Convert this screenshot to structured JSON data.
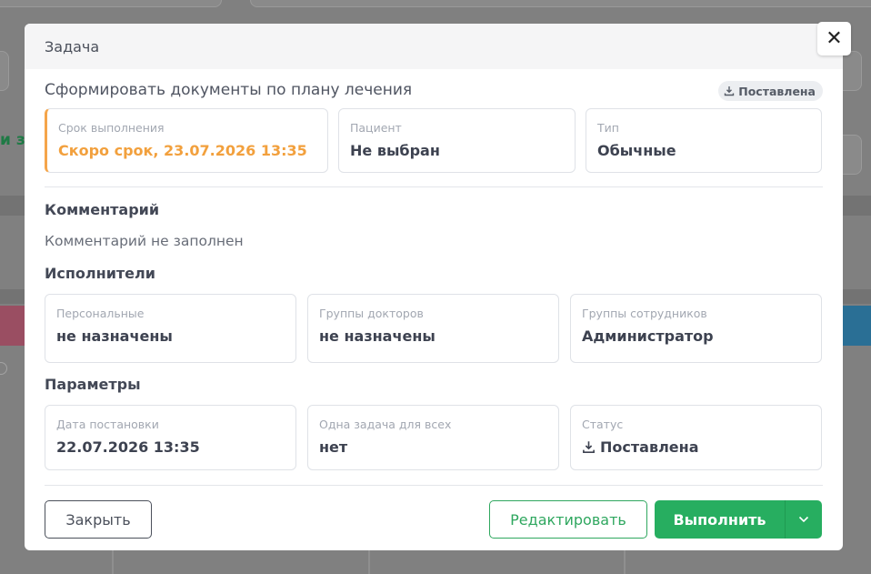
{
  "modal": {
    "title": "Задача",
    "close_symbol": "✕"
  },
  "task": {
    "name": "Сформировать документы по плану лечения",
    "badge": "Поставлена",
    "badge_icon": "download-icon"
  },
  "summary_cards": [
    {
      "label": "Срок выполнения",
      "value": "Скоро срок, 23.07.2026 13:35",
      "status_color": "#f2a03d"
    },
    {
      "label": "Пациент",
      "value": "Не выбран"
    },
    {
      "label": "Тип",
      "value": "Обычные"
    }
  ],
  "comment": {
    "heading": "Комментарий",
    "text": "Комментарий не заполнен"
  },
  "executors": {
    "heading": "Исполнители",
    "cards": [
      {
        "label": "Персональные",
        "value": "не назначены"
      },
      {
        "label": "Группы докторов",
        "value": "не назначены"
      },
      {
        "label": "Группы сотрудников",
        "value": "Администратор"
      }
    ]
  },
  "params": {
    "heading": "Параметры",
    "cards": [
      {
        "label": "Дата постановки",
        "value": "22.07.2026 13:35"
      },
      {
        "label": "Одна задача для всех",
        "value": "нет"
      },
      {
        "label": "Статус",
        "value": "Поставлена",
        "icon": "download-icon"
      }
    ]
  },
  "footer": {
    "close_label": "Закрыть",
    "edit_label": "Редактировать",
    "execute_label": "Выполнить"
  },
  "background": {
    "partial_text": "и з"
  },
  "colors": {
    "accent_green": "#27ae60",
    "warning_orange": "#f2a03d"
  }
}
